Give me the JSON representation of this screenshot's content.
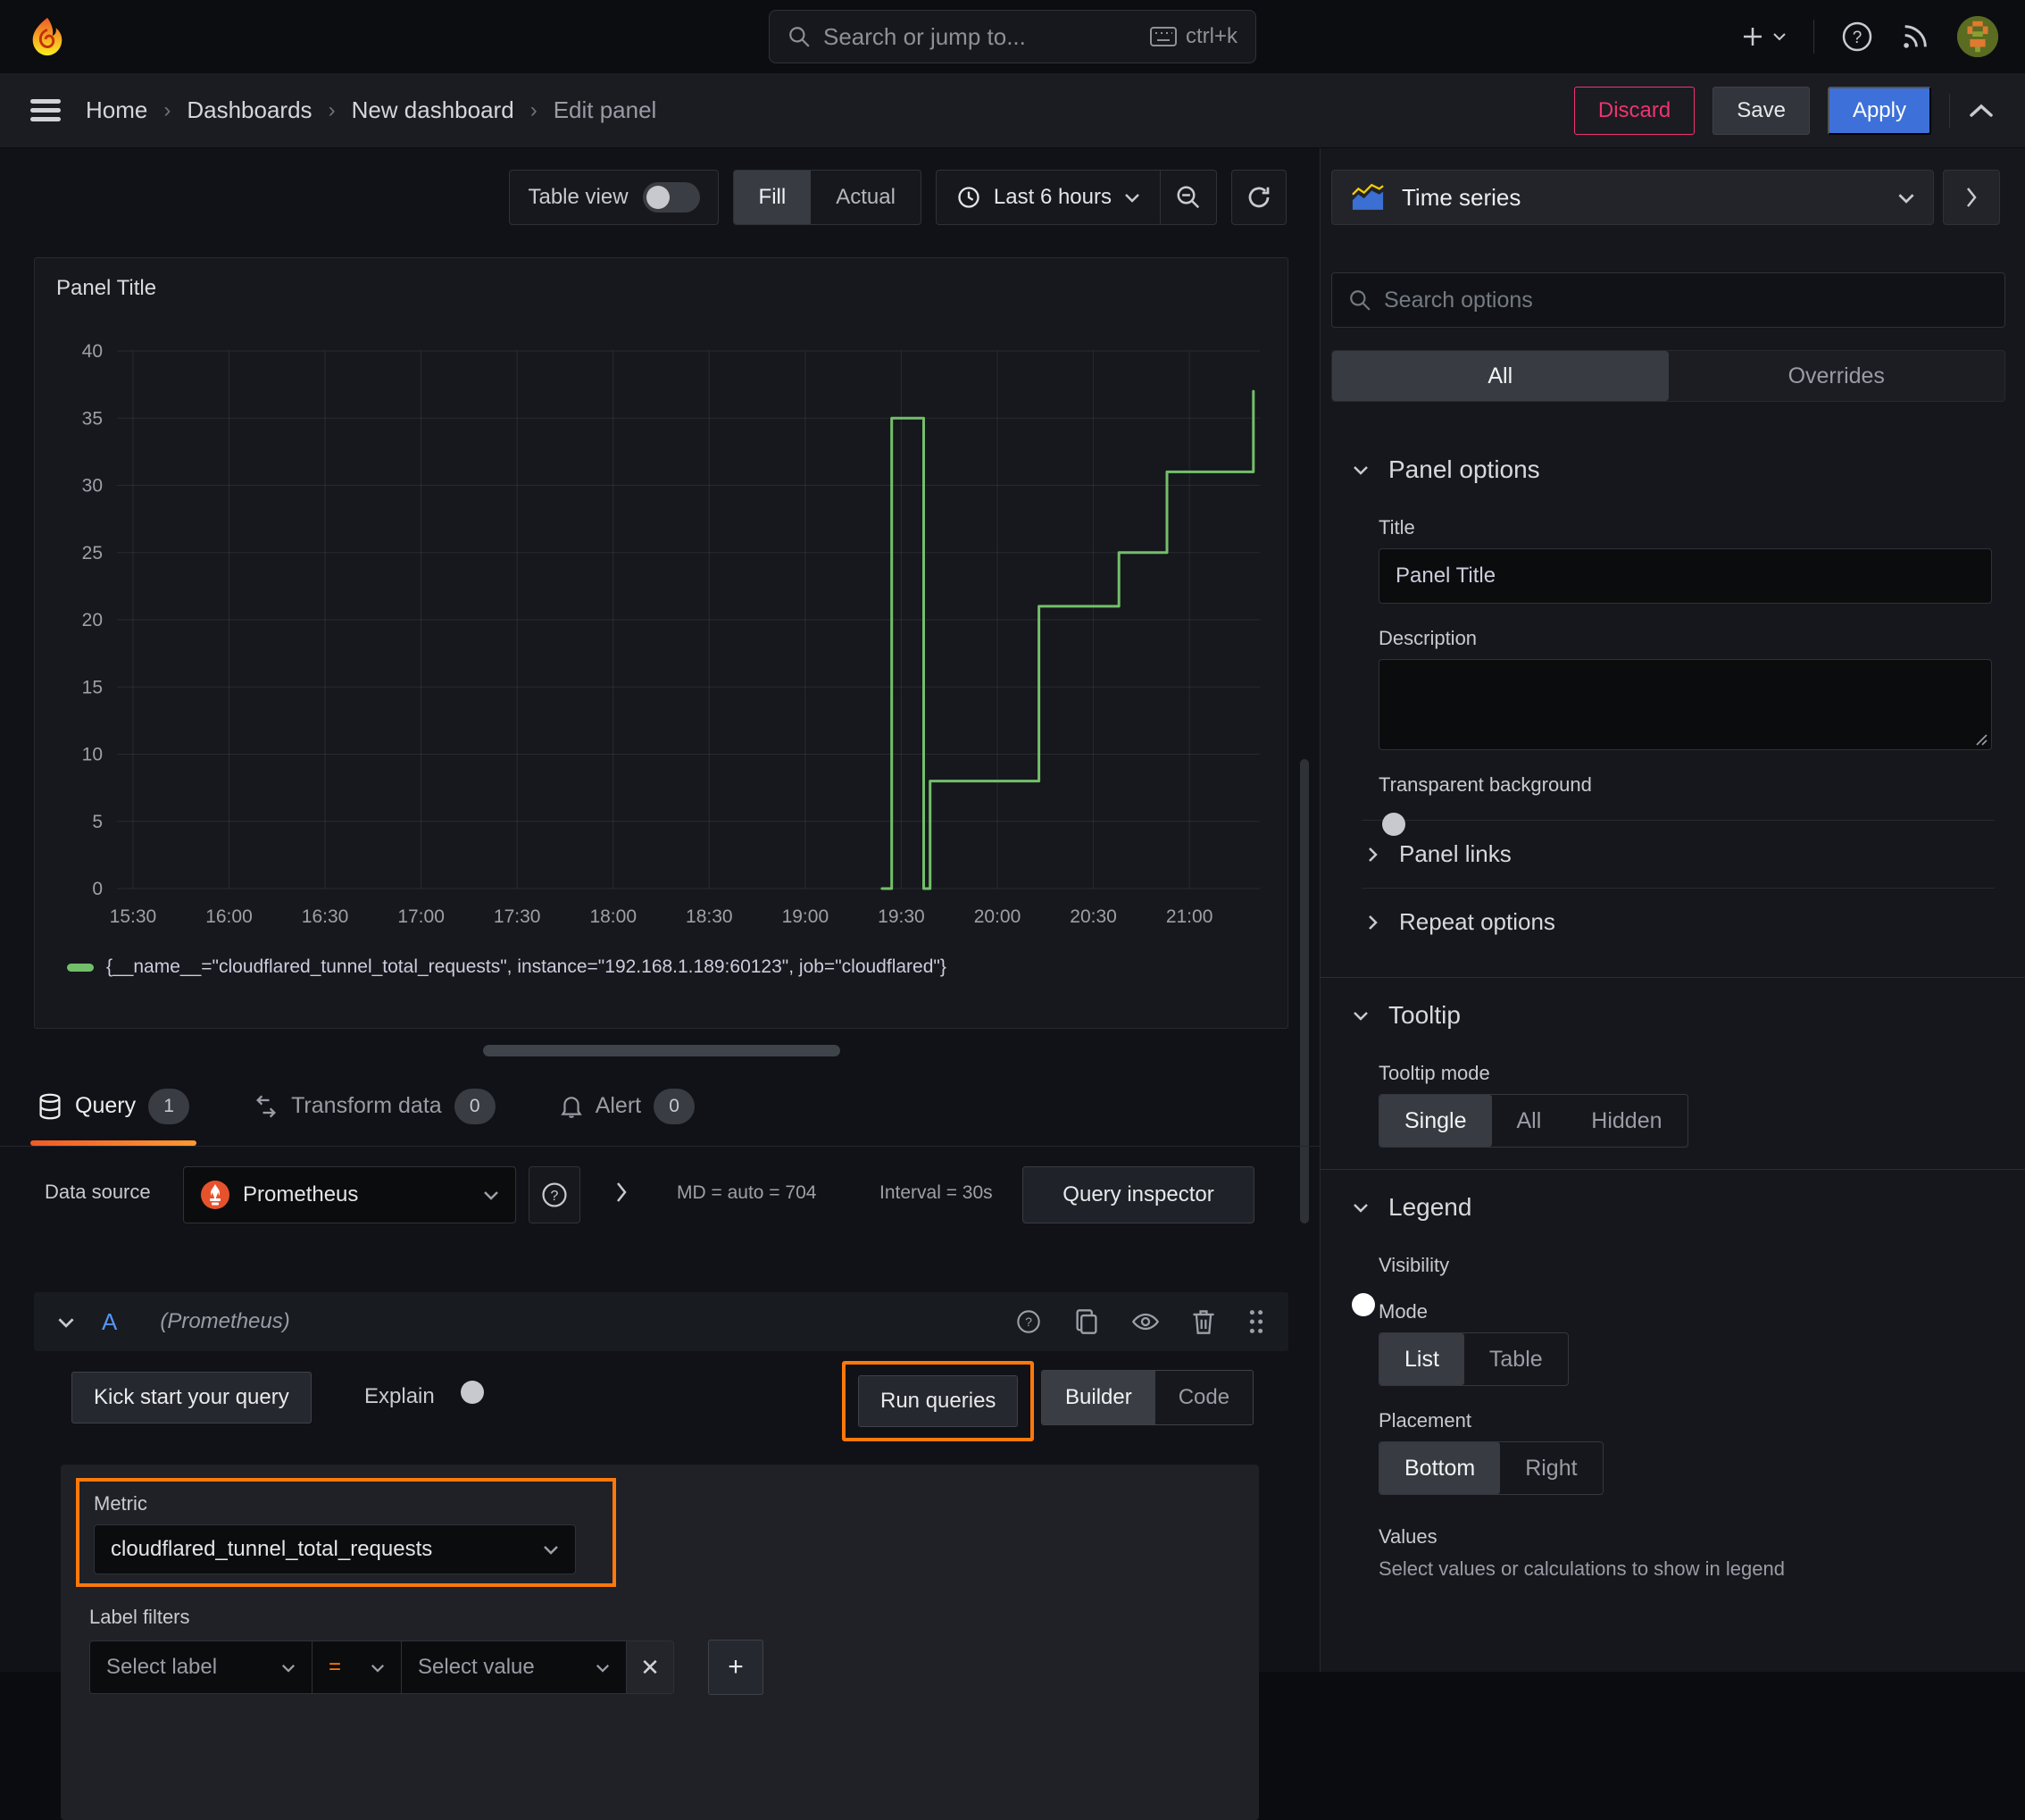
{
  "topbar": {
    "search_placeholder": "Search or jump to...",
    "search_shortcut": "ctrl+k"
  },
  "breadcrumb": {
    "items": [
      "Home",
      "Dashboards",
      "New dashboard",
      "Edit panel"
    ],
    "discard": "Discard",
    "save": "Save",
    "apply": "Apply"
  },
  "viz_toolbar": {
    "table_view": "Table view",
    "fill": "Fill",
    "actual": "Actual",
    "time_range": "Last 6 hours"
  },
  "chart_data": {
    "type": "line",
    "step": true,
    "title": "Panel Title",
    "grid": true,
    "legend_position": "bottom",
    "ylim": [
      0,
      40
    ],
    "y_ticks": [
      0,
      5,
      10,
      15,
      20,
      25,
      30,
      35,
      40
    ],
    "xlim_minutes": [
      925,
      1282
    ],
    "x_ticks": {
      "minutes": [
        930,
        960,
        990,
        1020,
        1050,
        1080,
        1110,
        1140,
        1170,
        1200,
        1230,
        1260
      ],
      "labels": [
        "15:30",
        "16:00",
        "16:30",
        "17:00",
        "17:30",
        "18:00",
        "18:30",
        "19:00",
        "19:30",
        "20:00",
        "20:30",
        "21:00"
      ]
    },
    "series": [
      {
        "name": "{__name__=\"cloudflared_tunnel_total_requests\", instance=\"192.168.1.189:60123\", job=\"cloudflared\"}",
        "color": "#73bf69",
        "points_minute_value": [
          [
            1164,
            0
          ],
          [
            1167,
            0
          ],
          [
            1167,
            35
          ],
          [
            1177,
            35
          ],
          [
            1177,
            0
          ],
          [
            1179,
            0
          ],
          [
            1179,
            8
          ],
          [
            1213,
            8
          ],
          [
            1213,
            21
          ],
          [
            1238,
            21
          ],
          [
            1238,
            25
          ],
          [
            1253,
            25
          ],
          [
            1253,
            31
          ],
          [
            1280,
            31
          ],
          [
            1280,
            37
          ]
        ]
      }
    ]
  },
  "tabs": {
    "query": "Query",
    "query_count": "1",
    "transform": "Transform data",
    "transform_count": "0",
    "alert": "Alert",
    "alert_count": "0"
  },
  "datasource": {
    "label": "Data source",
    "name": "Prometheus",
    "md": "MD = auto = 704",
    "interval": "Interval = 30s",
    "inspector": "Query inspector"
  },
  "query": {
    "ref_id": "A",
    "ds_hint": "(Prometheus)",
    "kick_start": "Kick start your query",
    "explain": "Explain",
    "run_queries": "Run queries",
    "builder": "Builder",
    "code": "Code",
    "metric_label": "Metric",
    "metric_value": "cloudflared_tunnel_total_requests",
    "label_filters": "Label filters",
    "select_label": "Select label",
    "operator": "=",
    "select_value": "Select value",
    "remove_glyph": "✕",
    "add_glyph": "+"
  },
  "options": {
    "viz_type": "Time series",
    "search_placeholder": "Search options",
    "tabs": {
      "all": "All",
      "overrides": "Overrides"
    },
    "panel_options": {
      "title": "Panel options",
      "title_label": "Title",
      "title_value": "Panel Title",
      "description_label": "Description",
      "transparent_label": "Transparent background"
    },
    "panel_links": "Panel links",
    "repeat_options": "Repeat options",
    "tooltip": {
      "title": "Tooltip",
      "mode_label": "Tooltip mode",
      "options": [
        "Single",
        "All",
        "Hidden"
      ]
    },
    "legend": {
      "title": "Legend",
      "visibility_label": "Visibility",
      "mode_label": "Mode",
      "mode_options": [
        "List",
        "Table"
      ],
      "placement_label": "Placement",
      "placement_options": [
        "Bottom",
        "Right"
      ],
      "values_label": "Values",
      "values_hint": "Select values or calculations to show in legend"
    }
  },
  "colors": {
    "accent_orange": "#ff780a",
    "series_green": "#73bf69",
    "primary_blue": "#3d71d9",
    "danger_pink": "#f0336e"
  }
}
